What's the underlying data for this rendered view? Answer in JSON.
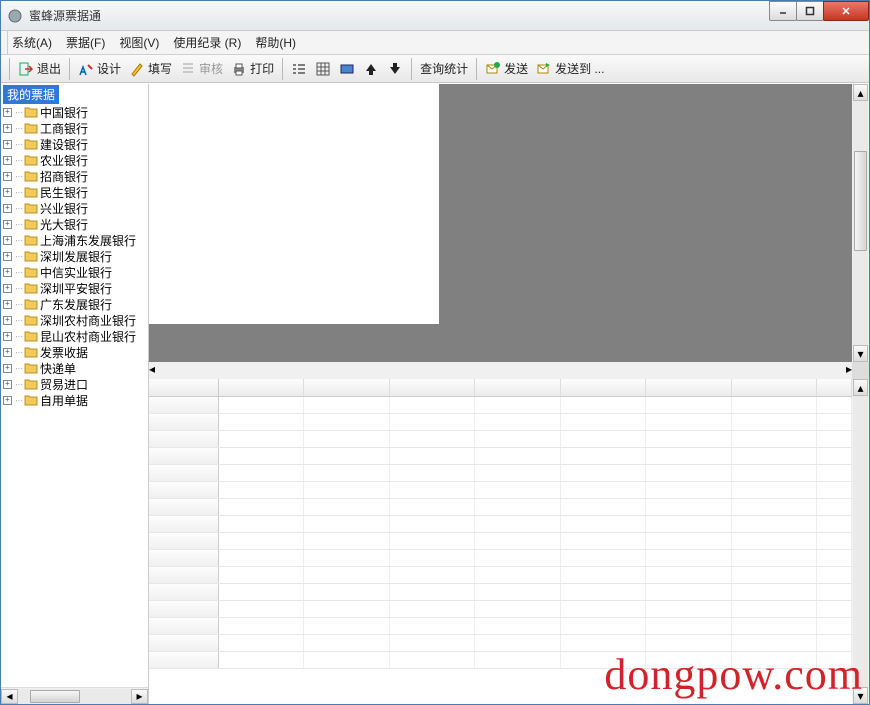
{
  "window": {
    "title": "蜜蜂源票据通"
  },
  "menu": {
    "items": [
      {
        "label": "系统(A)"
      },
      {
        "label": "票据(F)"
      },
      {
        "label": "视图(V)"
      },
      {
        "label": "使用纪录 (R)"
      },
      {
        "label": "帮助(H)"
      }
    ]
  },
  "toolbar": {
    "exit": "退出",
    "design": "设计",
    "fill": "填写",
    "review": "审核",
    "print": "打印",
    "query": "查询统计",
    "send": "发送",
    "sendto": "发送到 ..."
  },
  "tree": {
    "root": "我的票据",
    "items": [
      "中国银行",
      "工商银行",
      "建设银行",
      "农业银行",
      "招商银行",
      "民生银行",
      "兴业银行",
      "光大银行",
      "上海浦东发展银行",
      "深圳发展银行",
      "中信实业银行",
      "深圳平安银行",
      "广东发展银行",
      "深圳农村商业银行",
      "昆山农村商业银行",
      "发票收据",
      "快递单",
      "贸易进口",
      "自用单据"
    ]
  },
  "watermark": "dongpow.com"
}
